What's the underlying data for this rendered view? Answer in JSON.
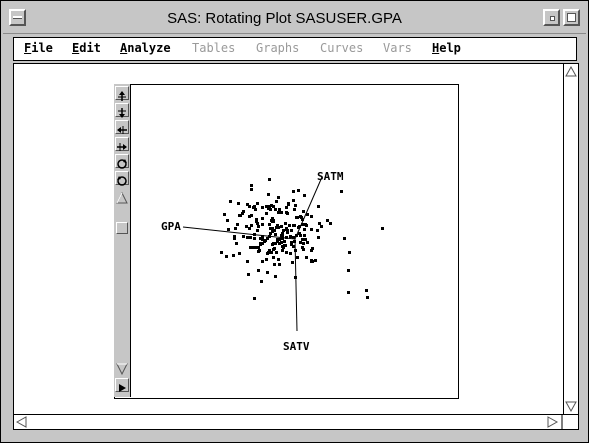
{
  "window": {
    "title": "SAS: Rotating Plot SASUSER.GPA"
  },
  "menu": [
    {
      "label": "File",
      "underline": "F",
      "rest": "ile",
      "enabled": true
    },
    {
      "label": "Edit",
      "underline": "E",
      "rest": "dit",
      "enabled": true
    },
    {
      "label": "Analyze",
      "underline": "A",
      "rest": "nalyze",
      "enabled": true
    },
    {
      "label": "Tables",
      "underline": "",
      "rest": "Tables",
      "enabled": false
    },
    {
      "label": "Graphs",
      "underline": "",
      "rest": "Graphs",
      "enabled": false
    },
    {
      "label": "Curves",
      "underline": "",
      "rest": "Curves",
      "enabled": false
    },
    {
      "label": "Vars",
      "underline": "",
      "rest": "Vars",
      "enabled": false
    },
    {
      "label": "Help",
      "underline": "H",
      "rest": "elp",
      "enabled": true
    }
  ],
  "tools": [
    {
      "icon": "rotate-up-icon"
    },
    {
      "icon": "rotate-down-icon"
    },
    {
      "icon": "rotate-left-icon"
    },
    {
      "icon": "rotate-right-icon"
    },
    {
      "icon": "rotate-clockwise-icon"
    },
    {
      "icon": "rotate-counterclockwise-icon"
    }
  ],
  "plot": {
    "axes": [
      {
        "name": "GPA"
      },
      {
        "name": "SATM"
      },
      {
        "name": "SATV"
      }
    ]
  }
}
